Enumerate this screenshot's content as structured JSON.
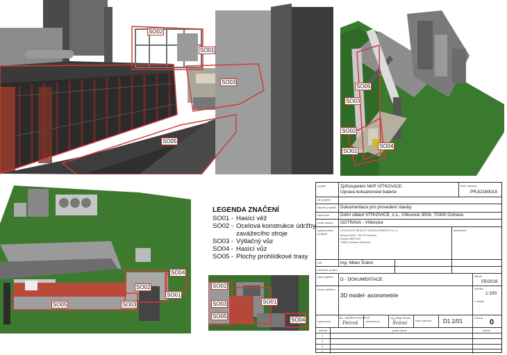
{
  "views": {
    "main": {
      "labels": {
        "so01": "SO01",
        "so02": "SO02",
        "so03": "SO03",
        "so05": "SO05"
      }
    },
    "aerial": {
      "labels": {
        "so01": "SO01",
        "so02": "SO02",
        "so03": "SO03",
        "so04": "SO04",
        "so05": "SO05"
      }
    },
    "plan": {
      "labels": {
        "so01": "SO01",
        "so02": "SO02",
        "so03": "SO03",
        "so04": "SO04",
        "so05": "SO05"
      }
    },
    "small": {
      "labels": {
        "so01": "SO01",
        "so02": "SO02",
        "so03": "SO03",
        "so04": "SO04",
        "so05": "SO05"
      }
    }
  },
  "legend": {
    "title": "LEGENDA ZNAČENÍ",
    "items": [
      {
        "code": "SO01 -",
        "text": "Hasící věž"
      },
      {
        "code": "SO02 -",
        "text": "Ocelová konstrukce údržby"
      },
      {
        "code": "",
        "text": "zavážecího stroje"
      },
      {
        "code": "SO03 -",
        "text": "Výtlačný vůz"
      },
      {
        "code": "SO04 -",
        "text": "Hasící vůz"
      },
      {
        "code": "SO05 -",
        "text": "Plochy prohlídkové trasy"
      }
    ]
  },
  "title_block": {
    "project_label": "projekt",
    "project_name_1": "Zpřístupnění NKP VÍTKOVICE-",
    "project_name_2": "Úprava koksárenské baterie",
    "project_no_label": "číslo zakázky",
    "project_no": "PRJO180018",
    "part_label": "díl projektu",
    "stage_label": "stupeň projektu",
    "stage": "Dokumentace pro provedení stavby",
    "builder_label": "stavebník",
    "builder": "Dolní oblast VÍTKOVICE, z.s., Vítkovice 3004, 70300 Ostrava",
    "site_label": "místo stavby",
    "site": "OSTRAVA - Vítkovice",
    "designer_label": "vypracovatel projektu",
    "designer_1": "VÍTKOVICE REALITY DEVELOPMENTS s.r.o.",
    "designer_2": "Mírová 3004, 703 00 Ostrava",
    "designer_3": "Ruská 2887/101",
    "designer_4": "70602 Ostrava-Vítkovice",
    "stamp_label": "autorizace",
    "gip_label": "HIP",
    "gip": "Ing. Milan Šrámi",
    "approver_label": "kontrolní zpráva",
    "section_label": "část projektu",
    "section": "D - DOKUMENTACE",
    "date_label": "datum",
    "date": "05/2018",
    "drawing_label": "název výkresu",
    "drawing": "3D model- axonometrie",
    "scale_label": "měřítko",
    "scale": "1:100",
    "copy_label": "č. kopie",
    "author_label": "vypracoval",
    "author": "Bc. JINDŘICH PETROŠ",
    "check_label": "kontroloval",
    "checker": "Ing. Milan Šrámi",
    "drawing_no_label": "číslo výkresu",
    "drawing_no": "D1.1/01",
    "change_label": "změna",
    "change_no": "0",
    "sig_author": "Petroš",
    "sig_check": "Šrámi",
    "rev_col1": "změna",
    "rev_col2": "popis úprav",
    "rev_col3": "datum",
    "rev_rows": [
      "1",
      "2",
      "3",
      "4"
    ]
  }
}
